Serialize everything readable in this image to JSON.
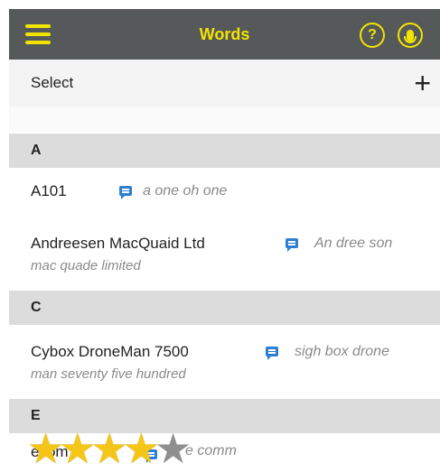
{
  "header": {
    "title": "Words",
    "help_icon": "help-circle-icon",
    "mic_icon": "microphone-icon",
    "accent": "#f2e400",
    "bg": "#56595a"
  },
  "toolbar": {
    "select_label": "Select",
    "add_label": "+"
  },
  "sections": [
    {
      "letter": "A"
    },
    {
      "letter": "C"
    },
    {
      "letter": "E"
    }
  ],
  "words": [
    {
      "word": "A101",
      "pronunciation": "a one oh one",
      "sounds_like": ""
    },
    {
      "word": "Andreesen MacQuaid Ltd",
      "pronunciation": "An dree son",
      "sounds_like": "mac quade limited"
    },
    {
      "word": "Cybox DroneMan 7500",
      "pronunciation": "sigh box drone",
      "sounds_like": "man seventy five hundred"
    },
    {
      "word": "e...omm",
      "pronunciation": "e comm",
      "sounds_like": ""
    }
  ],
  "rating": {
    "filled": 4,
    "total": 5
  },
  "partial": {
    "word": "ecom",
    "pron": "e comm"
  }
}
